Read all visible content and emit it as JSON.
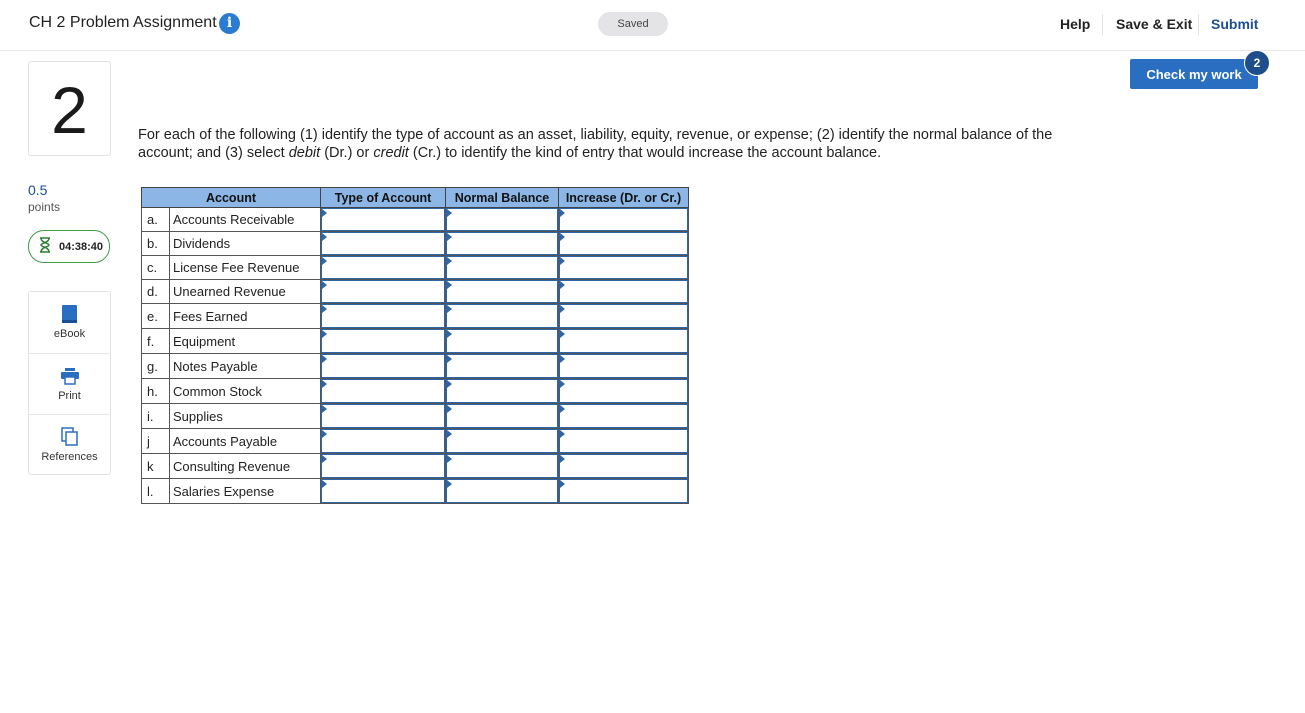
{
  "header": {
    "title": "CH 2 Problem Assignment",
    "info_icon": "i",
    "status": "Saved",
    "help": "Help",
    "save_exit": "Save & Exit",
    "submit": "Submit"
  },
  "question": {
    "number": "2",
    "points_value": "0.5",
    "points_label": "points",
    "timer": "04:38:40"
  },
  "tools": [
    {
      "label": "eBook",
      "icon": "book-icon"
    },
    {
      "label": "Print",
      "icon": "printer-icon"
    },
    {
      "label": "References",
      "icon": "copy-pages-icon"
    }
  ],
  "check": {
    "label": "Check my work",
    "badge": "2"
  },
  "instructions": {
    "part1": "For each of the following (1) identify the type of account as an asset, liability, equity, revenue, or expense; (2) identify the normal balance of the account; and (3) select ",
    "debit": "debit",
    "dr": "(Dr.)",
    "or": " or ",
    "credit": "credit",
    "cr": "(Cr.)",
    "part2": " to identify the kind of entry that would increase the account balance."
  },
  "table": {
    "headers": [
      "Account",
      "Type of Account",
      "Normal Balance",
      "Increase (Dr. or Cr.)"
    ],
    "rows": [
      {
        "letter": "a.",
        "name": "Accounts Receivable"
      },
      {
        "letter": "b.",
        "name": "Dividends"
      },
      {
        "letter": "c.",
        "name": "License Fee Revenue"
      },
      {
        "letter": "d.",
        "name": "Unearned Revenue"
      },
      {
        "letter": "e.",
        "name": "Fees Earned"
      },
      {
        "letter": "f.",
        "name": "Equipment"
      },
      {
        "letter": "g.",
        "name": "Notes Payable"
      },
      {
        "letter": "h.",
        "name": "Common Stock"
      },
      {
        "letter": "i.",
        "name": "Supplies"
      },
      {
        "letter": "j",
        "name": "Accounts Payable"
      },
      {
        "letter": "k",
        "name": "Consulting Revenue"
      },
      {
        "letter": "l.",
        "name": "Salaries Expense"
      }
    ]
  }
}
